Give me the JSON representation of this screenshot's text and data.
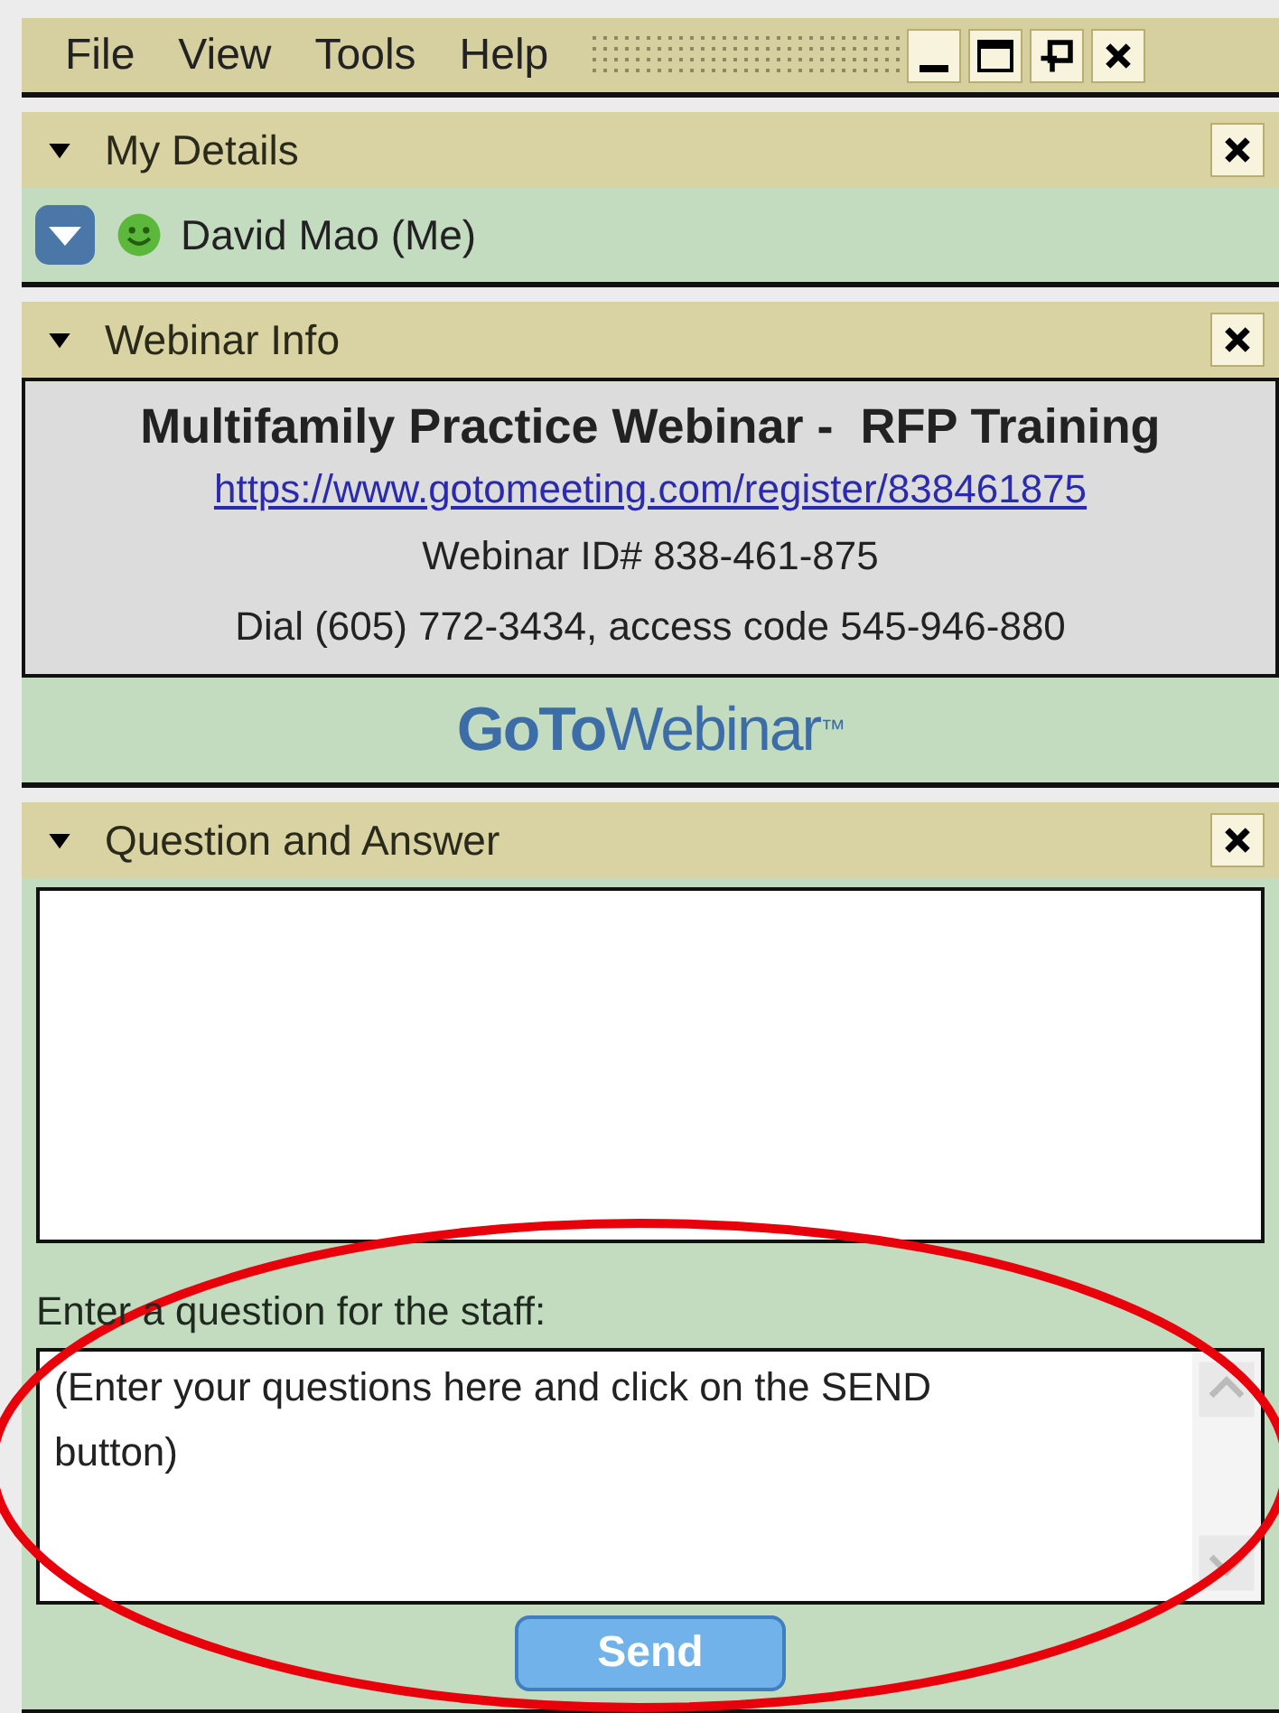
{
  "menu_bar": {
    "items": [
      "File",
      "View",
      "Tools",
      "Help"
    ]
  },
  "panels": [
    {
      "kind": "details",
      "title": "My Details",
      "expanded": true,
      "user": "David Mao (Me)"
    },
    {
      "kind": "info",
      "title": "Webinar Info",
      "expanded": true,
      "webinar_title": "Multifamily Practice Webinar -  RFP Training",
      "link": "https://www.gotomeeting.com/register/838461875",
      "webinar_id": "Webinar ID# 838-461-875",
      "dial": "Dial (605) 772-3434, access code 545-946-880",
      "logo": {
        "bold": "GoTo",
        "light": "Webinar",
        "mark": "™"
      }
    },
    {
      "kind": "qa",
      "title": "Question and Answer",
      "expanded": true,
      "prompt": "Enter a question for the staff:",
      "placeholder": "(Enter your questions here and click on the SEND button)",
      "send": "Send"
    }
  ]
}
